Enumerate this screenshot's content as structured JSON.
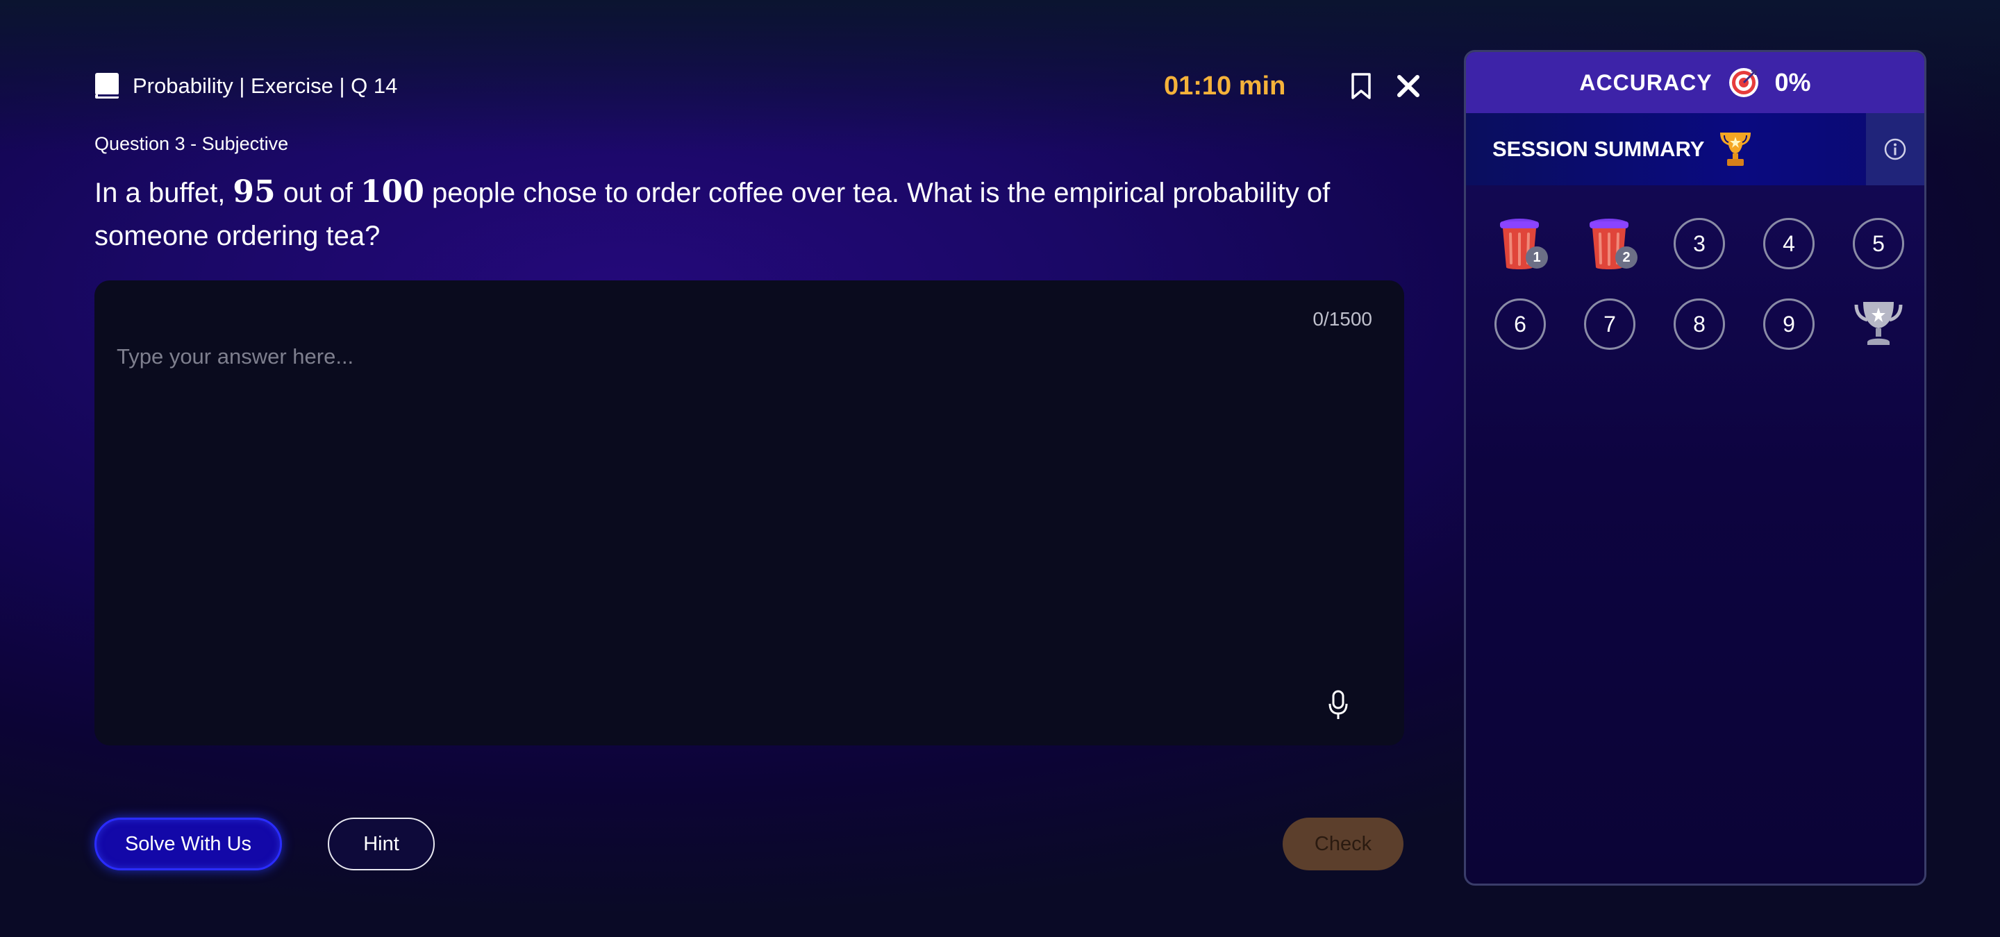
{
  "header": {
    "breadcrumb": "Probability | Exercise | Q 14",
    "timer": "01:10 min"
  },
  "question": {
    "type_label": "Question 3 - Subjective",
    "text_part1": "In a buffet, ",
    "num1": "95",
    "text_part2": " out of ",
    "num2": "100",
    "text_part3": " people chose to order coffee over tea. What is the empirical probability of someone ordering tea?"
  },
  "answer": {
    "counter": "0/1500",
    "placeholder": "Type your answer here...",
    "value": ""
  },
  "actions": {
    "solve_label": "Solve With Us",
    "hint_label": "Hint",
    "check_label": "Check"
  },
  "panel": {
    "accuracy_label": "ACCURACY",
    "accuracy_value": "0%",
    "summary_label": "SESSION SUMMARY",
    "questions": [
      {
        "label": "1",
        "state": "attempted-incorrect"
      },
      {
        "label": "2",
        "state": "attempted-incorrect"
      },
      {
        "label": "3",
        "state": "pending"
      },
      {
        "label": "4",
        "state": "pending"
      },
      {
        "label": "5",
        "state": "pending"
      },
      {
        "label": "6",
        "state": "pending"
      },
      {
        "label": "7",
        "state": "pending"
      },
      {
        "label": "8",
        "state": "pending"
      },
      {
        "label": "9",
        "state": "pending"
      },
      {
        "label": "",
        "state": "trophy"
      }
    ]
  },
  "colors": {
    "timer": "#f5b23a",
    "accuracy_bar": "#3d23a8",
    "solve_button": "#1308a8",
    "check_button": "#5c3f2c"
  },
  "icons": [
    "book-icon",
    "bookmark-icon",
    "close-icon",
    "mic-icon",
    "target-icon",
    "trophy-icon",
    "info-icon",
    "cup-icon",
    "silver-trophy-icon"
  ]
}
